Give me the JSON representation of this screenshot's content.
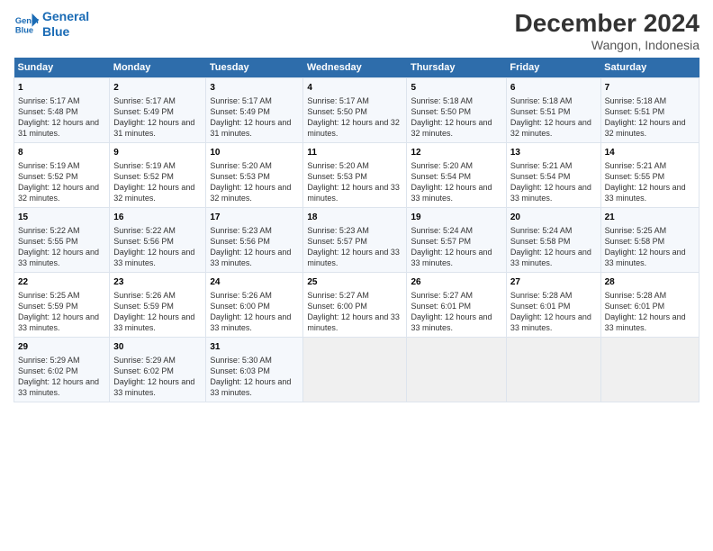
{
  "logo": {
    "line1": "General",
    "line2": "Blue"
  },
  "title": "December 2024",
  "subtitle": "Wangon, Indonesia",
  "header_days": [
    "Sunday",
    "Monday",
    "Tuesday",
    "Wednesday",
    "Thursday",
    "Friday",
    "Saturday"
  ],
  "weeks": [
    [
      {
        "day": "1",
        "sunrise": "5:17 AM",
        "sunset": "5:48 PM",
        "daylight": "12 hours and 31 minutes."
      },
      {
        "day": "2",
        "sunrise": "5:17 AM",
        "sunset": "5:49 PM",
        "daylight": "12 hours and 31 minutes."
      },
      {
        "day": "3",
        "sunrise": "5:17 AM",
        "sunset": "5:49 PM",
        "daylight": "12 hours and 31 minutes."
      },
      {
        "day": "4",
        "sunrise": "5:17 AM",
        "sunset": "5:50 PM",
        "daylight": "12 hours and 32 minutes."
      },
      {
        "day": "5",
        "sunrise": "5:18 AM",
        "sunset": "5:50 PM",
        "daylight": "12 hours and 32 minutes."
      },
      {
        "day": "6",
        "sunrise": "5:18 AM",
        "sunset": "5:51 PM",
        "daylight": "12 hours and 32 minutes."
      },
      {
        "day": "7",
        "sunrise": "5:18 AM",
        "sunset": "5:51 PM",
        "daylight": "12 hours and 32 minutes."
      }
    ],
    [
      {
        "day": "8",
        "sunrise": "5:19 AM",
        "sunset": "5:52 PM",
        "daylight": "12 hours and 32 minutes."
      },
      {
        "day": "9",
        "sunrise": "5:19 AM",
        "sunset": "5:52 PM",
        "daylight": "12 hours and 32 minutes."
      },
      {
        "day": "10",
        "sunrise": "5:20 AM",
        "sunset": "5:53 PM",
        "daylight": "12 hours and 32 minutes."
      },
      {
        "day": "11",
        "sunrise": "5:20 AM",
        "sunset": "5:53 PM",
        "daylight": "12 hours and 33 minutes."
      },
      {
        "day": "12",
        "sunrise": "5:20 AM",
        "sunset": "5:54 PM",
        "daylight": "12 hours and 33 minutes."
      },
      {
        "day": "13",
        "sunrise": "5:21 AM",
        "sunset": "5:54 PM",
        "daylight": "12 hours and 33 minutes."
      },
      {
        "day": "14",
        "sunrise": "5:21 AM",
        "sunset": "5:55 PM",
        "daylight": "12 hours and 33 minutes."
      }
    ],
    [
      {
        "day": "15",
        "sunrise": "5:22 AM",
        "sunset": "5:55 PM",
        "daylight": "12 hours and 33 minutes."
      },
      {
        "day": "16",
        "sunrise": "5:22 AM",
        "sunset": "5:56 PM",
        "daylight": "12 hours and 33 minutes."
      },
      {
        "day": "17",
        "sunrise": "5:23 AM",
        "sunset": "5:56 PM",
        "daylight": "12 hours and 33 minutes."
      },
      {
        "day": "18",
        "sunrise": "5:23 AM",
        "sunset": "5:57 PM",
        "daylight": "12 hours and 33 minutes."
      },
      {
        "day": "19",
        "sunrise": "5:24 AM",
        "sunset": "5:57 PM",
        "daylight": "12 hours and 33 minutes."
      },
      {
        "day": "20",
        "sunrise": "5:24 AM",
        "sunset": "5:58 PM",
        "daylight": "12 hours and 33 minutes."
      },
      {
        "day": "21",
        "sunrise": "5:25 AM",
        "sunset": "5:58 PM",
        "daylight": "12 hours and 33 minutes."
      }
    ],
    [
      {
        "day": "22",
        "sunrise": "5:25 AM",
        "sunset": "5:59 PM",
        "daylight": "12 hours and 33 minutes."
      },
      {
        "day": "23",
        "sunrise": "5:26 AM",
        "sunset": "5:59 PM",
        "daylight": "12 hours and 33 minutes."
      },
      {
        "day": "24",
        "sunrise": "5:26 AM",
        "sunset": "6:00 PM",
        "daylight": "12 hours and 33 minutes."
      },
      {
        "day": "25",
        "sunrise": "5:27 AM",
        "sunset": "6:00 PM",
        "daylight": "12 hours and 33 minutes."
      },
      {
        "day": "26",
        "sunrise": "5:27 AM",
        "sunset": "6:01 PM",
        "daylight": "12 hours and 33 minutes."
      },
      {
        "day": "27",
        "sunrise": "5:28 AM",
        "sunset": "6:01 PM",
        "daylight": "12 hours and 33 minutes."
      },
      {
        "day": "28",
        "sunrise": "5:28 AM",
        "sunset": "6:01 PM",
        "daylight": "12 hours and 33 minutes."
      }
    ],
    [
      {
        "day": "29",
        "sunrise": "5:29 AM",
        "sunset": "6:02 PM",
        "daylight": "12 hours and 33 minutes."
      },
      {
        "day": "30",
        "sunrise": "5:29 AM",
        "sunset": "6:02 PM",
        "daylight": "12 hours and 33 minutes."
      },
      {
        "day": "31",
        "sunrise": "5:30 AM",
        "sunset": "6:03 PM",
        "daylight": "12 hours and 33 minutes."
      },
      null,
      null,
      null,
      null
    ]
  ],
  "labels": {
    "sunrise": "Sunrise:",
    "sunset": "Sunset:",
    "daylight": "Daylight:"
  }
}
